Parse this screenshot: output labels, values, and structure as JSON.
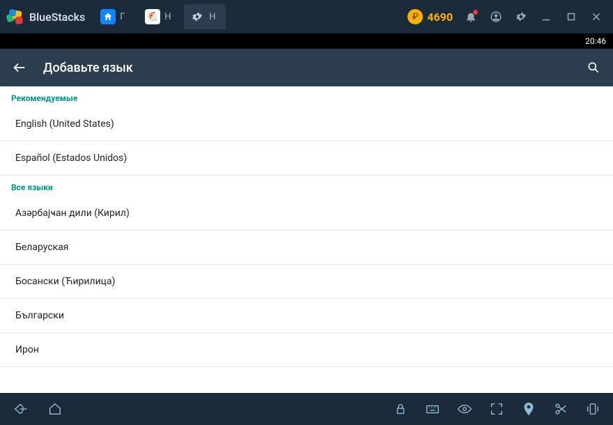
{
  "titlebar": {
    "app_name": "BlueStacks",
    "tabs": [
      {
        "label": "Г"
      },
      {
        "label": "Н"
      },
      {
        "label": "Н"
      }
    ],
    "coins": "4690"
  },
  "statusbar": {
    "time": "20:46"
  },
  "appheader": {
    "title": "Добавьте язык"
  },
  "sections": {
    "recommended_header": "Рекомендуемые",
    "recommended": [
      "English (United States)",
      "Español (Estados Unidos)"
    ],
    "all_header": "Все языки",
    "all": [
      "Азәрбајҹан дили (Кирил)",
      "Беларуская",
      "Босански (Ћирилица)",
      "Български",
      "Ирон"
    ]
  }
}
